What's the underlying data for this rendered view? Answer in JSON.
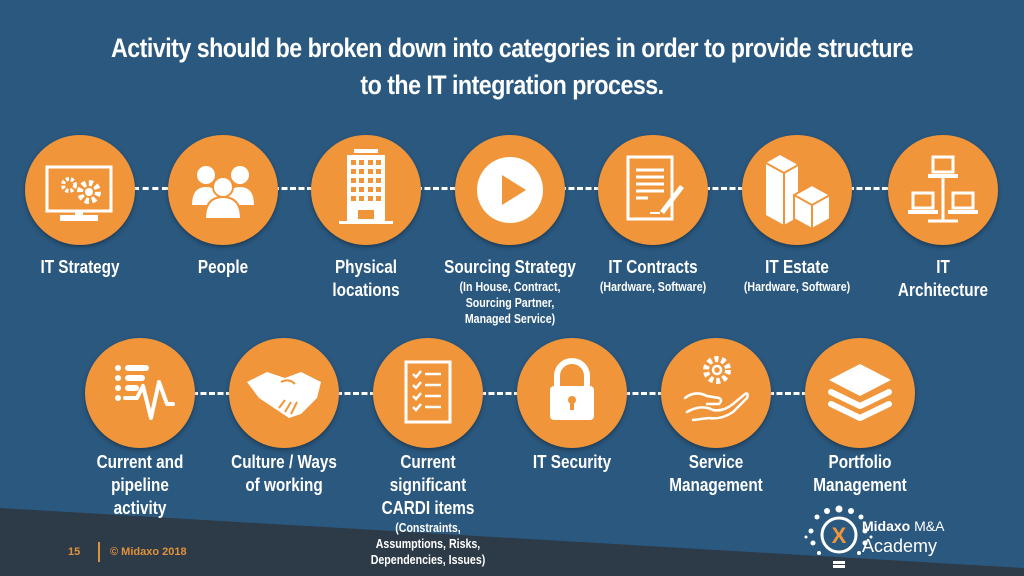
{
  "title": {
    "line1": "Activity should be broken down into categories in order to provide structure",
    "line2": "to the IT integration process."
  },
  "colors": {
    "background": "#2b587f",
    "footer_band": "#2d3a47",
    "circle": "#f0953a",
    "icon": "#ffffff",
    "accent": "#e0913c"
  },
  "row1": [
    {
      "label": "IT Strategy",
      "sub": "",
      "icon": "monitor-gears-icon"
    },
    {
      "label": "People",
      "sub": "",
      "icon": "people-group-icon"
    },
    {
      "label": "Physical locations",
      "sub": "",
      "icon": "office-building-icon"
    },
    {
      "label": "Sourcing Strategy",
      "sub": "(In House, Contract, Sourcing Partner, Managed Service)",
      "icon": "play-button-icon"
    },
    {
      "label": "IT Contracts",
      "sub": "(Hardware, Software)",
      "icon": "contract-signature-icon"
    },
    {
      "label": "IT Estate",
      "sub": "(Hardware, Software)",
      "icon": "boxes-icon"
    },
    {
      "label": "IT Architecture",
      "sub": "",
      "icon": "network-computers-icon"
    }
  ],
  "row2": [
    {
      "label": "Current and pipeline activity",
      "sub": "",
      "icon": "list-pulse-icon"
    },
    {
      "label": "Culture / Ways of working",
      "sub": "",
      "icon": "handshake-icon"
    },
    {
      "label": "Current significant CARDI items",
      "sub": "(Constraints, Assumptions, Risks, Dependencies, Issues)",
      "icon": "checklist-icon"
    },
    {
      "label": "IT Security",
      "sub": "",
      "icon": "padlock-icon"
    },
    {
      "label": "Service Management",
      "sub": "",
      "icon": "hand-gear-icon"
    },
    {
      "label": "Portfolio Management",
      "sub": "",
      "icon": "layers-icon"
    }
  ],
  "footer": {
    "page_number": "15",
    "copyright": "© Midaxo 2018"
  },
  "logo": {
    "brand": "Midaxo",
    "line1_suffix": "M&A",
    "line2": "Academy",
    "mark": "X"
  }
}
